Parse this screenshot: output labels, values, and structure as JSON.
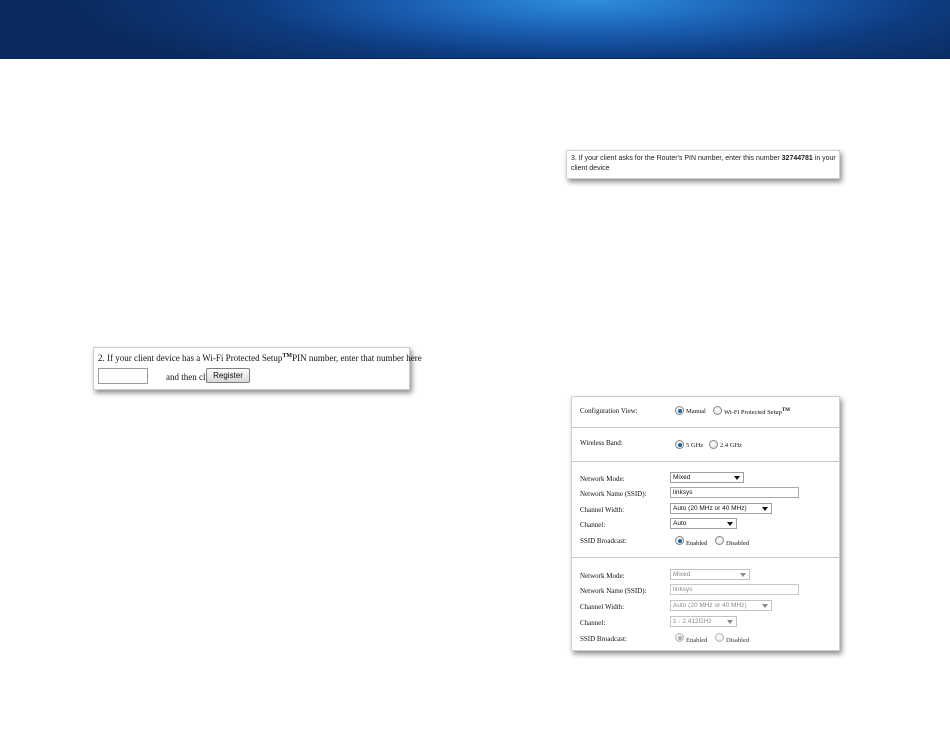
{
  "wps_pin": {
    "line1_pre": "2. If your client device has a Wi-Fi Protected Setup",
    "tm": "TM",
    "line1_post": "PIN number, enter that number here",
    "input_value": "",
    "then_text": "and then click",
    "register_label": "Register"
  },
  "router_pin": {
    "pre": "3. If your client asks for the Router's PIN number, enter this number ",
    "number": "32744781",
    "post": " in your client device"
  },
  "wireless": {
    "config_view_label": "Configuration View:",
    "config_manual": "Manual",
    "config_wps": "Wi-Fi Protected Setup",
    "tm": "TM",
    "band_label": "Wireless Band:",
    "band_5": "5 GHz",
    "band_24": "2.4 GHz",
    "band5": {
      "network_mode_label": "Network Mode:",
      "network_mode_value": "Mixed",
      "ssid_label": "Network Name (SSID):",
      "ssid_value": "linksys",
      "channel_width_label": "Channel Width:",
      "channel_width_value": "Auto (20 MHz or 40 MHz)",
      "channel_label": "Channel:",
      "channel_value": "Auto",
      "ssid_broadcast_label": "SSID Broadcast:",
      "enabled": "Enabled",
      "disabled": "Disabled"
    },
    "band24": {
      "network_mode_label": "Network Mode:",
      "network_mode_value": "Mixed",
      "ssid_label": "Network Name (SSID):",
      "ssid_value": "linksys",
      "channel_width_label": "Channel Width:",
      "channel_width_value": "Auto (20 MHz or 40 MHz)",
      "channel_label": "Channel:",
      "channel_value": "1 - 2.412GHz",
      "ssid_broadcast_label": "SSID Broadcast:",
      "enabled": "Enabled",
      "disabled": "Disabled"
    }
  },
  "colors": {
    "banner": "#1a5fb3",
    "radio_selected": "#1f5fae"
  }
}
